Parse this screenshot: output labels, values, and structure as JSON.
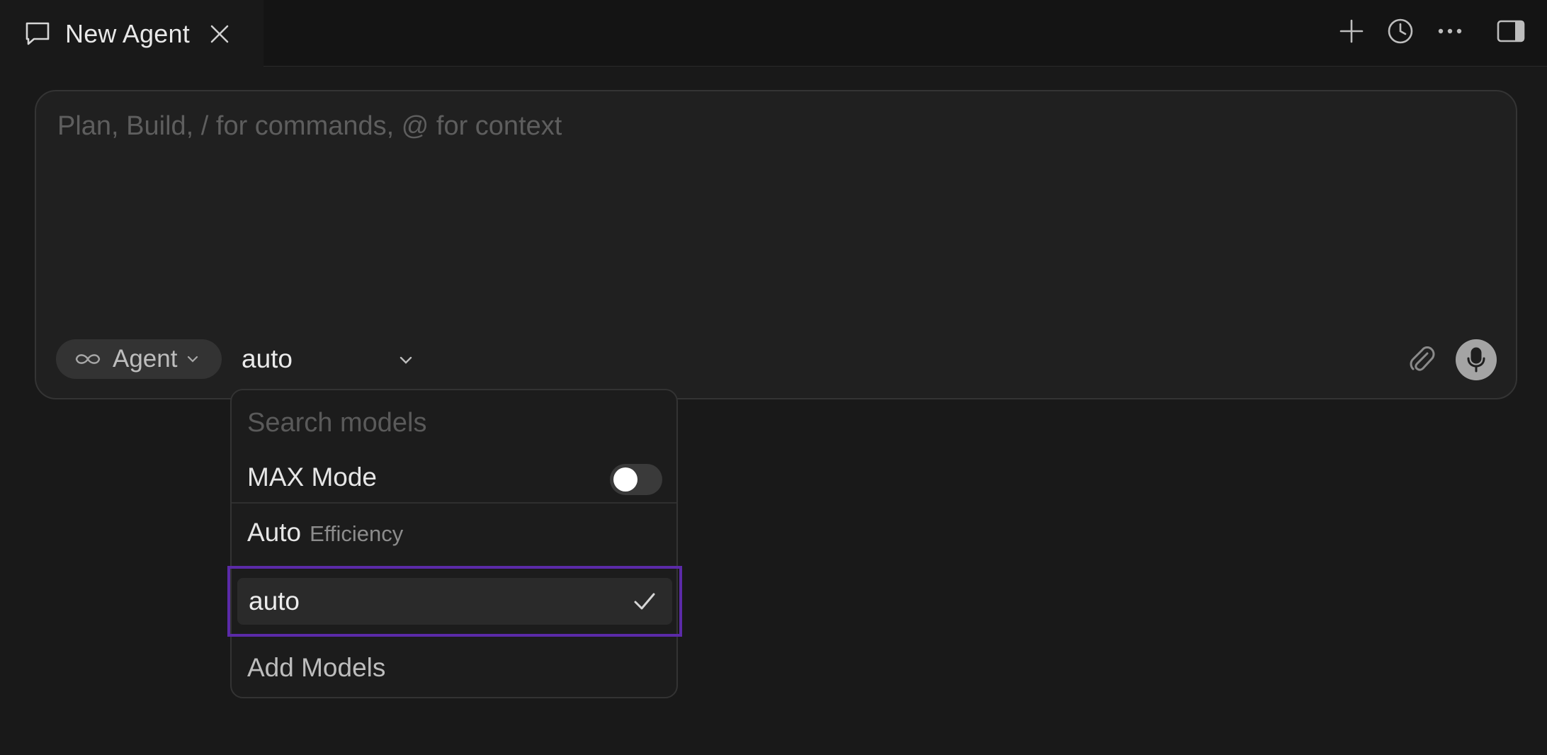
{
  "tab": {
    "title": "New Agent"
  },
  "toolbar": {
    "icons": [
      "plus-icon",
      "history-icon",
      "more-icon",
      "sidebar-toggle-icon"
    ]
  },
  "composer": {
    "placeholder": "Plan, Build, / for commands, @ for context",
    "value": "",
    "mode_label": "Agent",
    "model_label": "auto"
  },
  "dropdown": {
    "search_placeholder": "Search models",
    "max_mode_label": "MAX Mode",
    "max_mode_enabled": false,
    "section_title": "Auto",
    "section_subtitle": "Efficiency",
    "items": [
      {
        "label": "auto",
        "selected": true
      }
    ],
    "add_models_label": "Add Models"
  },
  "colors": {
    "background": "#191919",
    "tabbar": "#141414",
    "composer": "#202020",
    "selection_outline": "#5b2aa8",
    "mic_button": "#a4a4a4"
  }
}
